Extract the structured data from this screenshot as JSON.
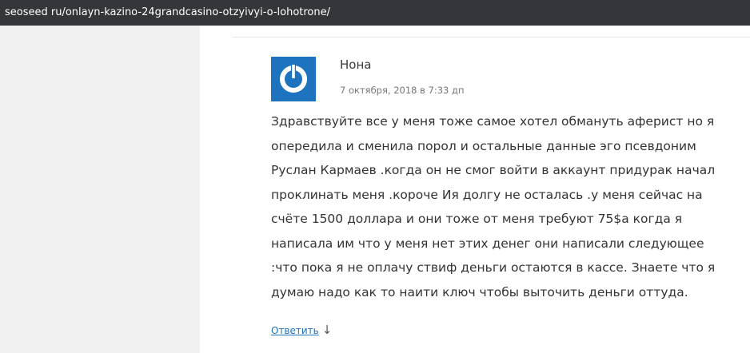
{
  "browser": {
    "url": "seoseed ru/onlayn-kazino-24grandcasino-otzyivyi-o-lohotrone/"
  },
  "comment": {
    "author": "Нона",
    "date": "7 октября, 2018 в 7:33 дп",
    "avatar_icon": "power-icon",
    "avatar_color": "#1e73be",
    "text_lines": [
      "Здравствуйте все у меня тоже самое хотел обмануть аферист но я",
      "опередила и сменила порол и остальные данные эго псевдоним",
      "Руслан Кармаев .когда он не смог войти в аккаунт придурак начал",
      "проклинать меня .короче Ия долгу не осталась .у меня сейчас на",
      "счёте 1500 доллара и они тоже от меня требуют 75$а когда я",
      "написала им что у меня нет этих денег они написали следующее",
      ":что пока я не оплачу ствиф деньги остаются в кассе. Знаете что я",
      "думаю надо как то наити ключ чтобы выточить деньги оттуда."
    ],
    "reply_label": "Ответить",
    "reply_icon": "arrow-down-icon",
    "reply_arrow": "↓"
  }
}
